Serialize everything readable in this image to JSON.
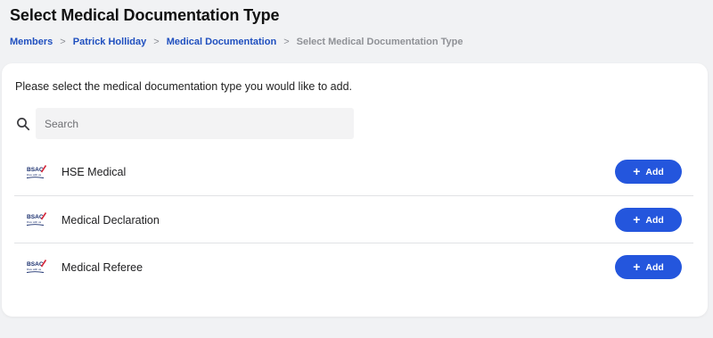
{
  "page": {
    "title": "Select Medical Documentation Type"
  },
  "breadcrumb": {
    "items": [
      {
        "label": "Members"
      },
      {
        "label": "Patrick Holliday"
      },
      {
        "label": "Medical Documentation"
      }
    ],
    "separator": ">",
    "current": "Select Medical Documentation Type"
  },
  "card": {
    "instruction": "Please select the medical documentation type you would like to add."
  },
  "search": {
    "placeholder": "Search",
    "value": "",
    "icon": "search-icon"
  },
  "documentation_types": [
    {
      "label": "HSE Medical",
      "logo_text": "BSAC",
      "logo_tagline": "Dive with us",
      "button_label": "Add",
      "button_icon": "plus-icon"
    },
    {
      "label": "Medical Declaration",
      "logo_text": "BSAC",
      "logo_tagline": "Dive with us",
      "button_label": "Add",
      "button_icon": "plus-icon"
    },
    {
      "label": "Medical Referee",
      "logo_text": "BSAC",
      "logo_tagline": "Dive with us",
      "button_label": "Add",
      "button_icon": "plus-icon"
    }
  ],
  "colors": {
    "accent": "#2456dd",
    "link": "#1f4fbf",
    "background": "#f1f2f4",
    "card": "#ffffff"
  }
}
